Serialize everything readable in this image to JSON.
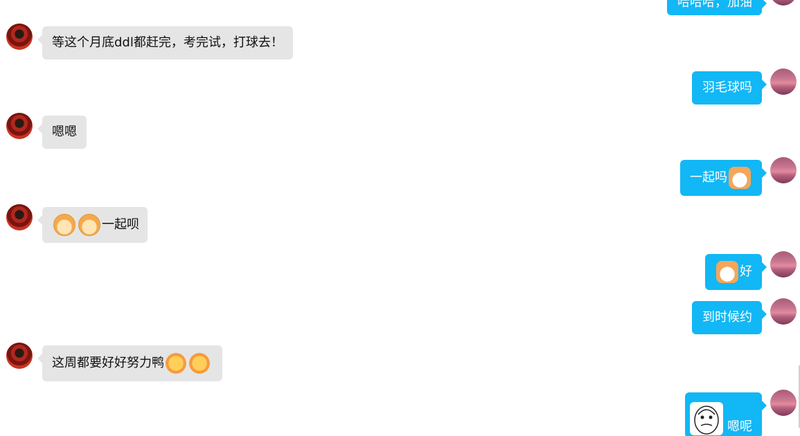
{
  "conversation": {
    "messages": [
      {
        "side": "right",
        "text": "哈哈哈，加油"
      },
      {
        "side": "left",
        "text": "等这个月底ddl都赶完，考完试，打球去！"
      },
      {
        "side": "right",
        "text": "羽毛球吗"
      },
      {
        "side": "left",
        "text": "嗯嗯"
      },
      {
        "side": "right",
        "text": "一起吗",
        "emoji": "cat-emoji"
      },
      {
        "side": "left",
        "text": "一起呗",
        "emoji": "dog-emoji x2"
      },
      {
        "side": "right",
        "text": "好",
        "emoji": "cat-emoji"
      },
      {
        "side": "right",
        "text": "到时候约"
      },
      {
        "side": "left",
        "text": "这周都要好好努力鸭",
        "emoji": "sun-emoji x2"
      },
      {
        "side": "right",
        "text": "嗯呢",
        "sticker": "cartoon-face-sticker"
      }
    ]
  },
  "colors": {
    "incoming_bubble": "#e5e5e5",
    "outgoing_bubble": "#12b7f5",
    "incoming_text": "#111111",
    "outgoing_text": "#ffffff"
  }
}
